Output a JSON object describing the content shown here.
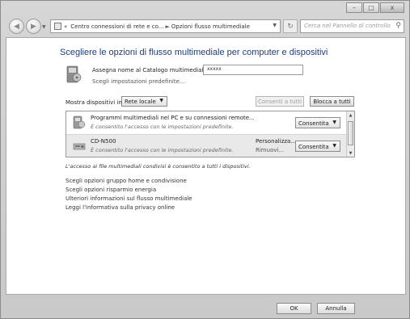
{
  "window": {
    "controls": {
      "minimize": "–",
      "maximize": "□",
      "close": "x"
    }
  },
  "nav": {
    "back_glyph": "◀",
    "forward_glyph": "▶",
    "breadcrumb": [
      "«",
      "Centro connessioni di rete e co...",
      "►",
      "Opzioni flusso multimediale"
    ],
    "refresh_glyph": "↻",
    "search_placeholder": "Cerca nel Pannello di controllo"
  },
  "main": {
    "heading": "Scegliere le opzioni di flusso multimediale per computer e dispositivi",
    "library_name_label": "Assegna nome al Catalogo multimediale:",
    "library_name_value": "xxxxx",
    "choose_defaults_link": "Scegli impostazioni predefinite...",
    "show_devices_label": "Mostra dispositivi in:",
    "show_devices_value": "Rete locale",
    "allow_all_button": "Consenti a tutti",
    "block_all_button": "Blocca a tutti",
    "devices": [
      {
        "title": "Programmi multimediali nel PC e su connessioni remote...",
        "description": "È consentito l'accesso con le impostazioni predefinite.",
        "customize": "",
        "remove": "",
        "permission": "Consentita"
      },
      {
        "title": "CD-N500",
        "description": "È consentito l'accesso con le impostazioni predefinite.",
        "customize": "Personalizza...",
        "remove": "Rimuovi...",
        "permission": "Consentita"
      }
    ],
    "note": "L'accesso ai file multimediali condivisi è consentito a tutti i dispositivi.",
    "links": [
      "Scegli opzioni gruppo home e condivisione",
      "Scegli opzioni risparmio energia",
      "Ulteriori informazioni sul flusso multimediale",
      "Leggi l'informativa sulla privacy online"
    ]
  },
  "footer": {
    "ok_button": "OK",
    "cancel_button": "Annulla"
  },
  "colors": {
    "heading": "#1e3c7a",
    "window_frame": "#c9c9c9"
  },
  "icons": [
    "computer-media-icon",
    "stereo-device-icon",
    "search-icon",
    "refresh-icon",
    "back-arrow-icon",
    "forward-arrow-icon"
  ]
}
